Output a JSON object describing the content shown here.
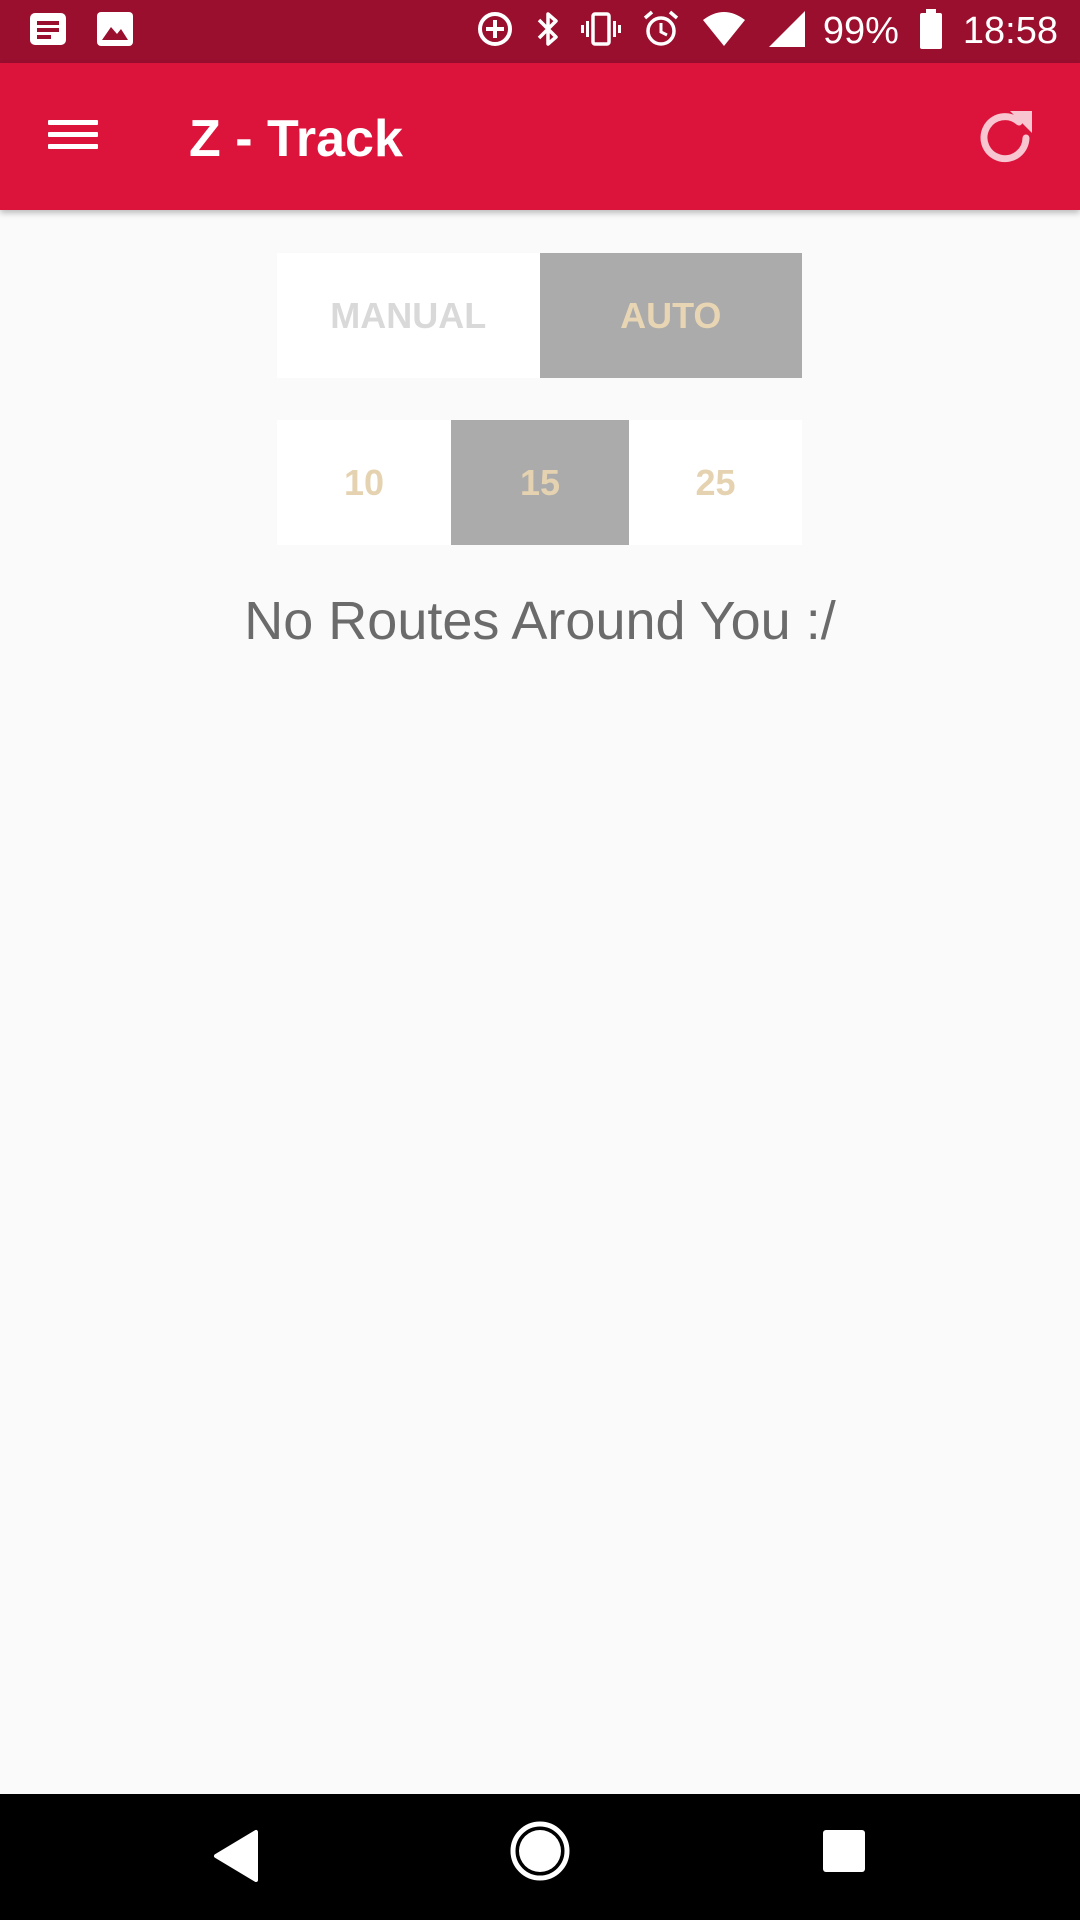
{
  "status_bar": {
    "battery_percent": "99%",
    "time": "18:58",
    "left_icons": [
      "notification-message-icon",
      "image-icon"
    ],
    "right_icons": [
      "data-saver-icon",
      "bluetooth-icon",
      "vibrate-icon",
      "alarm-icon",
      "wifi-icon",
      "signal-icon",
      "battery-icon"
    ]
  },
  "app_bar": {
    "title": "Z - Track",
    "menu_icon": "hamburger-menu-icon",
    "action_icon": "refresh-icon"
  },
  "mode_selector": {
    "options": [
      "MANUAL",
      "AUTO"
    ],
    "selected": "AUTO"
  },
  "distance_selector": {
    "options": [
      "10",
      "15",
      "25"
    ],
    "selected": "15"
  },
  "empty_state": {
    "message": "No Routes Around You :/"
  },
  "colors": {
    "status_bar": "#9A0E2E",
    "app_bar": "#DC143C",
    "selected_segment": "#ABABAB",
    "segment_text": "#E5D2B0",
    "background": "#FAFAFA"
  }
}
